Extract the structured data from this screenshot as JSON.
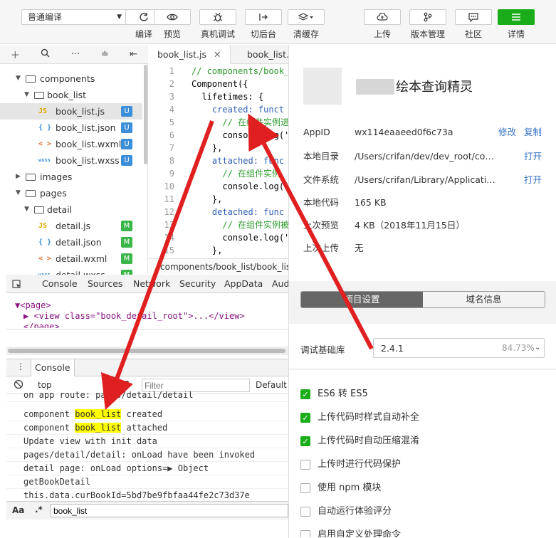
{
  "toolbar": {
    "mode": "普通编译",
    "buttons": [
      {
        "label": "编译",
        "icon": "refresh-icon"
      },
      {
        "label": "预览",
        "icon": "eye-icon"
      },
      {
        "label": "真机调试",
        "icon": "bug-icon"
      },
      {
        "label": "切后台",
        "icon": "switch-background-icon"
      },
      {
        "label": "清缓存",
        "icon": "layers-icon"
      },
      {
        "label": "上传",
        "icon": "cloud-upload-icon"
      },
      {
        "label": "版本管理",
        "icon": "branch-icon"
      },
      {
        "label": "社区",
        "icon": "chat-icon"
      },
      {
        "label": "详情",
        "icon": "menu-icon"
      }
    ]
  },
  "filetree": {
    "items": [
      {
        "name": "components",
        "type": "folder"
      },
      {
        "name": "book_list",
        "type": "folder"
      },
      {
        "name": "book_list.js",
        "icon": "JS",
        "badge": "U"
      },
      {
        "name": "book_list.json",
        "icon": "{ }",
        "badge": "U"
      },
      {
        "name": "book_list.wxml",
        "icon": "< >",
        "badge": "U"
      },
      {
        "name": "book_list.wxss",
        "icon": "wxss",
        "badge": "U"
      },
      {
        "name": "images",
        "type": "folder"
      },
      {
        "name": "pages",
        "type": "folder"
      },
      {
        "name": "detail",
        "type": "folder"
      },
      {
        "name": "detail.js",
        "icon": "JS",
        "badge": "M"
      },
      {
        "name": "detail.json",
        "icon": "{ }",
        "badge": "M"
      },
      {
        "name": "detail.wxml",
        "icon": "< >",
        "badge": "M"
      },
      {
        "name": "detail.wxss",
        "icon": "wxss",
        "badge": "M"
      }
    ]
  },
  "editor": {
    "tabs": [
      "book_list.js",
      "book_list."
    ],
    "lines": [
      {
        "n": "1",
        "text": "// components/book_"
      },
      {
        "n": "2",
        "text": "Component({"
      },
      {
        "n": "3",
        "text": "  lifetimes: {"
      },
      {
        "n": "4",
        "text": "    created: funct"
      },
      {
        "n": "5",
        "text": "      // 在组件实例进"
      },
      {
        "n": "6",
        "text": "      console.log('"
      },
      {
        "n": "7",
        "text": "    },"
      },
      {
        "n": "8",
        "text": "    attached: func"
      },
      {
        "n": "9",
        "text": "      // 在组件实例"
      },
      {
        "n": "10",
        "text": "      console.log('"
      },
      {
        "n": "11",
        "text": "    },"
      },
      {
        "n": "12",
        "text": "    detached: func"
      },
      {
        "n": "13",
        "text": "      // 在组件实例被"
      },
      {
        "n": "14",
        "text": "      console.log('"
      },
      {
        "n": "15",
        "text": "    },"
      }
    ],
    "path": "components/book_list/book_list.js"
  },
  "devtools": {
    "tabs": [
      "Console",
      "Sources",
      "Network",
      "Security",
      "AppData",
      "Aud"
    ],
    "elements": [
      "<page>",
      "<view class=\"book_detail_root\">...</view>",
      "</page>"
    ],
    "console_tab": "Console",
    "context": "top",
    "filter_placeholder": "Filter",
    "levels": "Default l",
    "logs": [
      "on app route: pages/detail/detail",
      "component book_list created",
      "component book_list attached",
      "Update view with init data",
      "pages/detail/detail: onLoad have been invoked",
      "detail page: onLoad options=▶ Object",
      "getBookDetail",
      "this.data.curBookId=5bd7be9fbfaa44fe2c73d37e"
    ],
    "highlight_word": "book_list",
    "find_value": "book_list",
    "find_case": "Aa",
    "find_regex": ".*"
  },
  "details": {
    "app_name": "绘本查询精灵",
    "rows": [
      {
        "key": "AppID",
        "value": "wx114eaaeed0f6c73a",
        "action1": "修改",
        "action2": "复制"
      },
      {
        "key": "本地目录",
        "value": "/Users/crifan/dev/dev_root/company/na...",
        "action1": "打开"
      },
      {
        "key": "文件系统",
        "value": "/Users/crifan/Library/Application Suppo...",
        "action1": "打开"
      },
      {
        "key": "本地代码",
        "value": "165 KB"
      },
      {
        "key": "上次预览",
        "value": "4 KB（2018年11月15日）"
      },
      {
        "key": "上次上传",
        "value": "无"
      }
    ],
    "segments": [
      "项目设置",
      "域名信息"
    ],
    "lib_label": "调试基础库",
    "lib_version": "2.4.1",
    "lib_percent": "84.73%",
    "options": [
      {
        "label": "ES6 转 ES5",
        "checked": true
      },
      {
        "label": "上传代码时样式自动补全",
        "checked": true
      },
      {
        "label": "上传代码时自动压缩混淆",
        "checked": true
      },
      {
        "label": "上传时进行代码保护",
        "checked": false
      },
      {
        "label": "使用 npm 模块",
        "checked": false
      },
      {
        "label": "自动运行体验评分",
        "checked": false
      },
      {
        "label": "启用自定义处理命令",
        "checked": false
      }
    ]
  },
  "colors": {
    "accent_green": "#1aad19",
    "link_blue": "#3372c6",
    "arrow_red": "#e02020"
  }
}
